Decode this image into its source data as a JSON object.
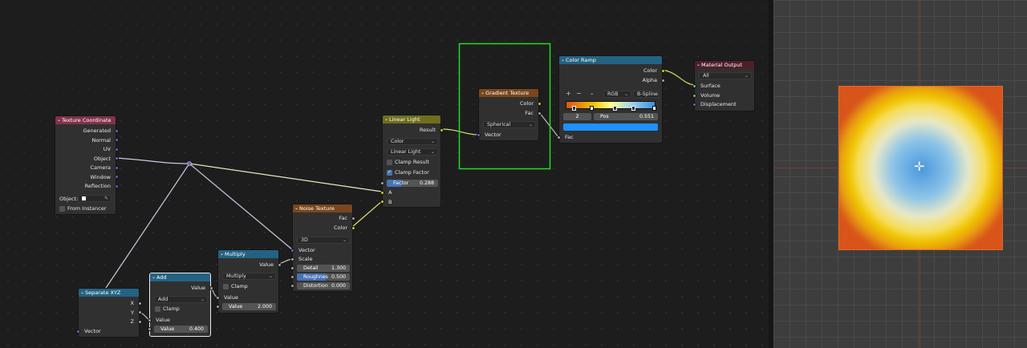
{
  "nodes": {
    "texcoord": {
      "title": "Texture Coordinate",
      "outputs": [
        "Generated",
        "Normal",
        "UV",
        "Object",
        "Camera",
        "Window",
        "Reflection"
      ],
      "object_label": "Object:",
      "from_instancer": "From Instancer"
    },
    "sepxyz": {
      "title": "Separate XYZ",
      "outputs": [
        "X",
        "Y",
        "Z"
      ],
      "input": "Vector"
    },
    "add": {
      "title": "Add",
      "output": "Value",
      "operation": "Add",
      "clamp": "Clamp",
      "input": "Value",
      "field_label": "Value",
      "field_value": "0.400"
    },
    "multiply": {
      "title": "Multiply",
      "output": "Value",
      "operation": "Multiply",
      "clamp": "Clamp",
      "input": "Value",
      "field_label": "Value",
      "field_value": "2.000"
    },
    "noise": {
      "title": "Noise Texture",
      "outputs": [
        "Fac",
        "Color"
      ],
      "dimensions": "3D",
      "inputs": [
        "Vector",
        "Scale"
      ],
      "fields": [
        {
          "label": "Detail",
          "value": "1.300"
        },
        {
          "label": "Roughnes",
          "value": "0.500"
        },
        {
          "label": "Distortion",
          "value": "0.000"
        }
      ]
    },
    "linear": {
      "title": "Linear Light",
      "output": "Result",
      "dropdowns": [
        "Color",
        "Linear Light"
      ],
      "clamp_result": "Clamp Result",
      "clamp_factor": "Clamp Factor",
      "factor_label": "Factor",
      "factor_value": "0.288",
      "inputs": [
        "A",
        "B"
      ]
    },
    "gradient": {
      "title": "Gradient Texture",
      "outputs": [
        "Color",
        "Fac"
      ],
      "type": "Spherical",
      "input": "Vector"
    },
    "ramp": {
      "title": "Color Ramp",
      "outputs": [
        "Color",
        "Alpha"
      ],
      "plus": "+",
      "minus": "−",
      "chev": "⌄",
      "color_mode": "RGB",
      "interp": "B-Spline",
      "index": "2",
      "pos_label": "Pos",
      "pos_value": "0.551",
      "input": "Fac"
    },
    "output": {
      "title": "Material Output",
      "target": "All",
      "inputs": [
        "Surface",
        "Volume",
        "Displacement"
      ]
    }
  },
  "colors": {
    "selection_box": "#22dd22",
    "ramp_selected": "#1e90ff",
    "preview_orange": "#d9541a"
  },
  "icons": {
    "chevron": "⌄",
    "eyedropper": "✎",
    "cursor": "✛"
  }
}
